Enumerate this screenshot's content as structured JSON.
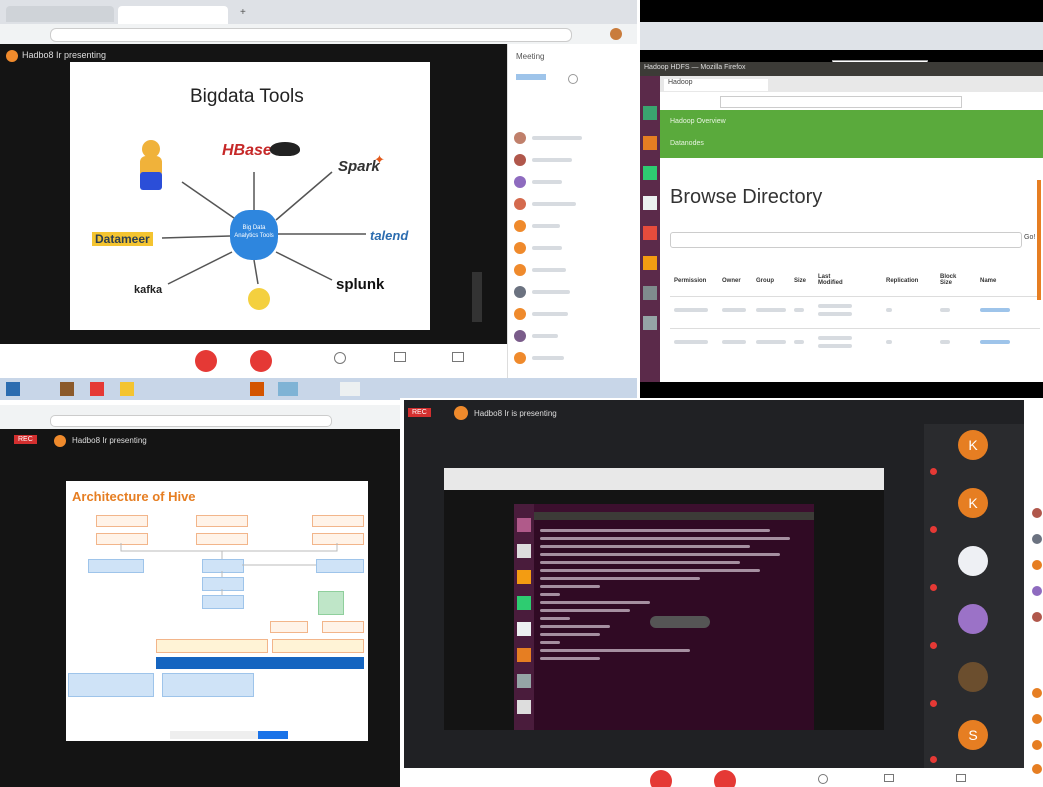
{
  "q1": {
    "presenter_title": "Hadbo8 Ir presenting",
    "slide_title": "Bigdata Tools",
    "center_label": "Big Data Analytics Tools",
    "labels": {
      "hbase": "HBase",
      "spark": "Spark",
      "datameer": "Datameer",
      "talend": "talend",
      "kafka": "kafka",
      "splunk": "splunk"
    },
    "participants_header": "Meeting"
  },
  "q2": {
    "browser_title": "Hadoop HDFS — Mozilla Firefox",
    "hdfs_tab": "Hadoop",
    "green_header_1": "Hadoop Overview",
    "green_header_2": "Datanodes",
    "heading": "Browse Directory",
    "go_button": "Go!",
    "table_headers": [
      "Permission",
      "Owner",
      "Group",
      "Size",
      "Last Modified",
      "Replication",
      "Block Size",
      "Name"
    ]
  },
  "q3": {
    "rec_label": "REC",
    "presenter_title": "Hadbo8 Ir presenting",
    "slide_title": "Architecture of Hive"
  },
  "q4": {
    "rec_label": "REC",
    "presenter_title": "Hadbo8 Ir is presenting",
    "participants": [
      {
        "initial": "K",
        "color": "#e67e22"
      },
      {
        "initial": "K",
        "color": "#e67e22"
      },
      {
        "initial": "",
        "color": "#eef0f4"
      },
      {
        "initial": "",
        "color": "#9b72c7"
      },
      {
        "initial": "",
        "color": "#6b4e2e"
      },
      {
        "initial": "S",
        "color": "#e67e22"
      }
    ]
  }
}
